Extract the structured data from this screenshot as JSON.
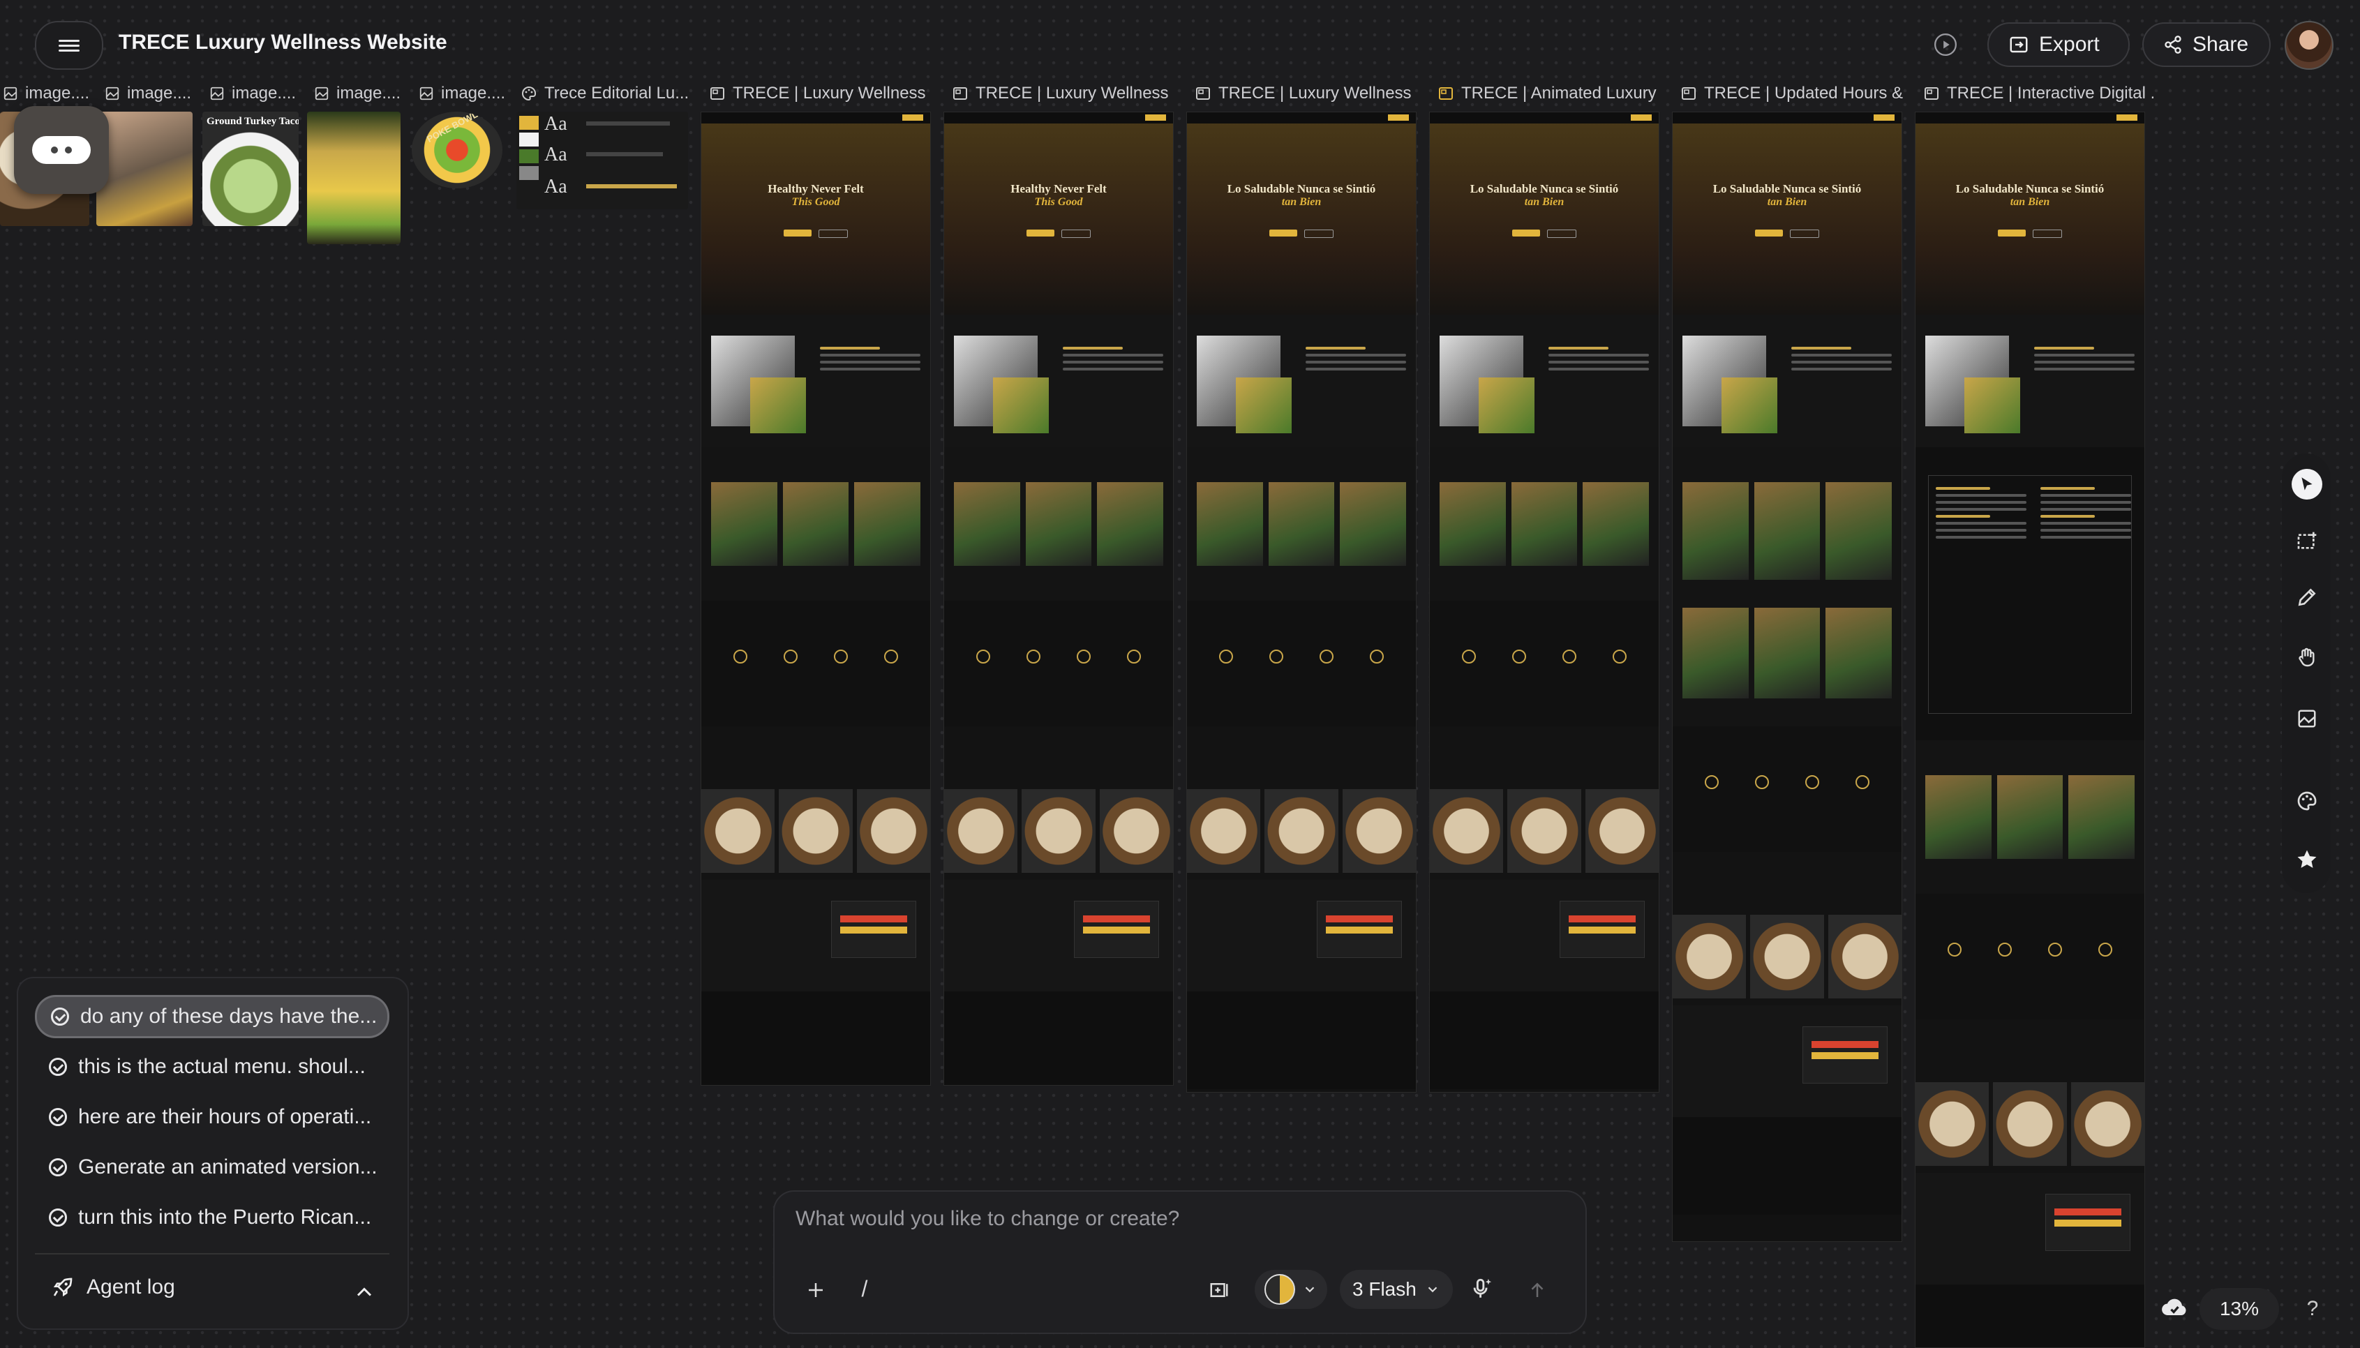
{
  "header": {
    "title": "TRECE Luxury Wellness Website",
    "export_label": "Export",
    "share_label": "Share"
  },
  "frames": [
    {
      "label": "image....",
      "icon": "image-icon"
    },
    {
      "label": "image....",
      "icon": "image-icon"
    },
    {
      "label": "image....",
      "icon": "image-icon"
    },
    {
      "label": "image....",
      "icon": "image-icon"
    },
    {
      "label": "image....",
      "icon": "image-icon"
    },
    {
      "label": "Trece Editorial Lu...",
      "icon": "palette-icon"
    },
    {
      "label": "TRECE | Luxury Wellness ...",
      "icon": "frame-icon"
    },
    {
      "label": "TRECE | Luxury Wellness ...",
      "icon": "frame-icon"
    },
    {
      "label": "TRECE | Luxury Wellness (...",
      "icon": "frame-icon"
    },
    {
      "label": "TRECE | Animated Luxury ...",
      "icon": "frame-icon"
    },
    {
      "label": "TRECE | Updated Hours & ...",
      "icon": "frame-icon"
    },
    {
      "label": "TRECE | Interactive Digital ...",
      "icon": "frame-icon"
    }
  ],
  "thumbnails": {
    "salad_label": "Ground Turkey Tacos",
    "bowl_label": "POKE BOWL",
    "typography": [
      "Aa",
      "Aa",
      "Aa"
    ]
  },
  "sites": [
    {
      "headline": "Healthy Never Felt",
      "headline_accent": "This Good"
    },
    {
      "headline": "Healthy Never Felt",
      "headline_accent": "This Good"
    },
    {
      "headline": "Lo Saludable Nunca se Sintió",
      "headline_accent": "tan Bien"
    },
    {
      "headline": "Lo Saludable Nunca se Sintió",
      "headline_accent": "tan Bien"
    },
    {
      "headline": "Lo Saludable Nunca se Sintió",
      "headline_accent": "tan Bien"
    },
    {
      "headline": "Lo Saludable Nunca se Sintió",
      "headline_accent": "tan Bien"
    }
  ],
  "history": {
    "items": [
      "do any of these days have the...",
      "this is the actual menu. shoul...",
      "here are their hours of operati...",
      "Generate an animated version...",
      "turn this into the Puerto Rican..."
    ],
    "selected_index": 0,
    "agent_log_label": "Agent log"
  },
  "prompt": {
    "placeholder": "What would you like to change or create?",
    "slash": "/",
    "model": "3 Flash"
  },
  "zoom": "13%",
  "help": "?",
  "colors": {
    "accent_gold": "#e2b53c",
    "accent_red": "#d9432f",
    "canvas": "#1c1c1e"
  }
}
